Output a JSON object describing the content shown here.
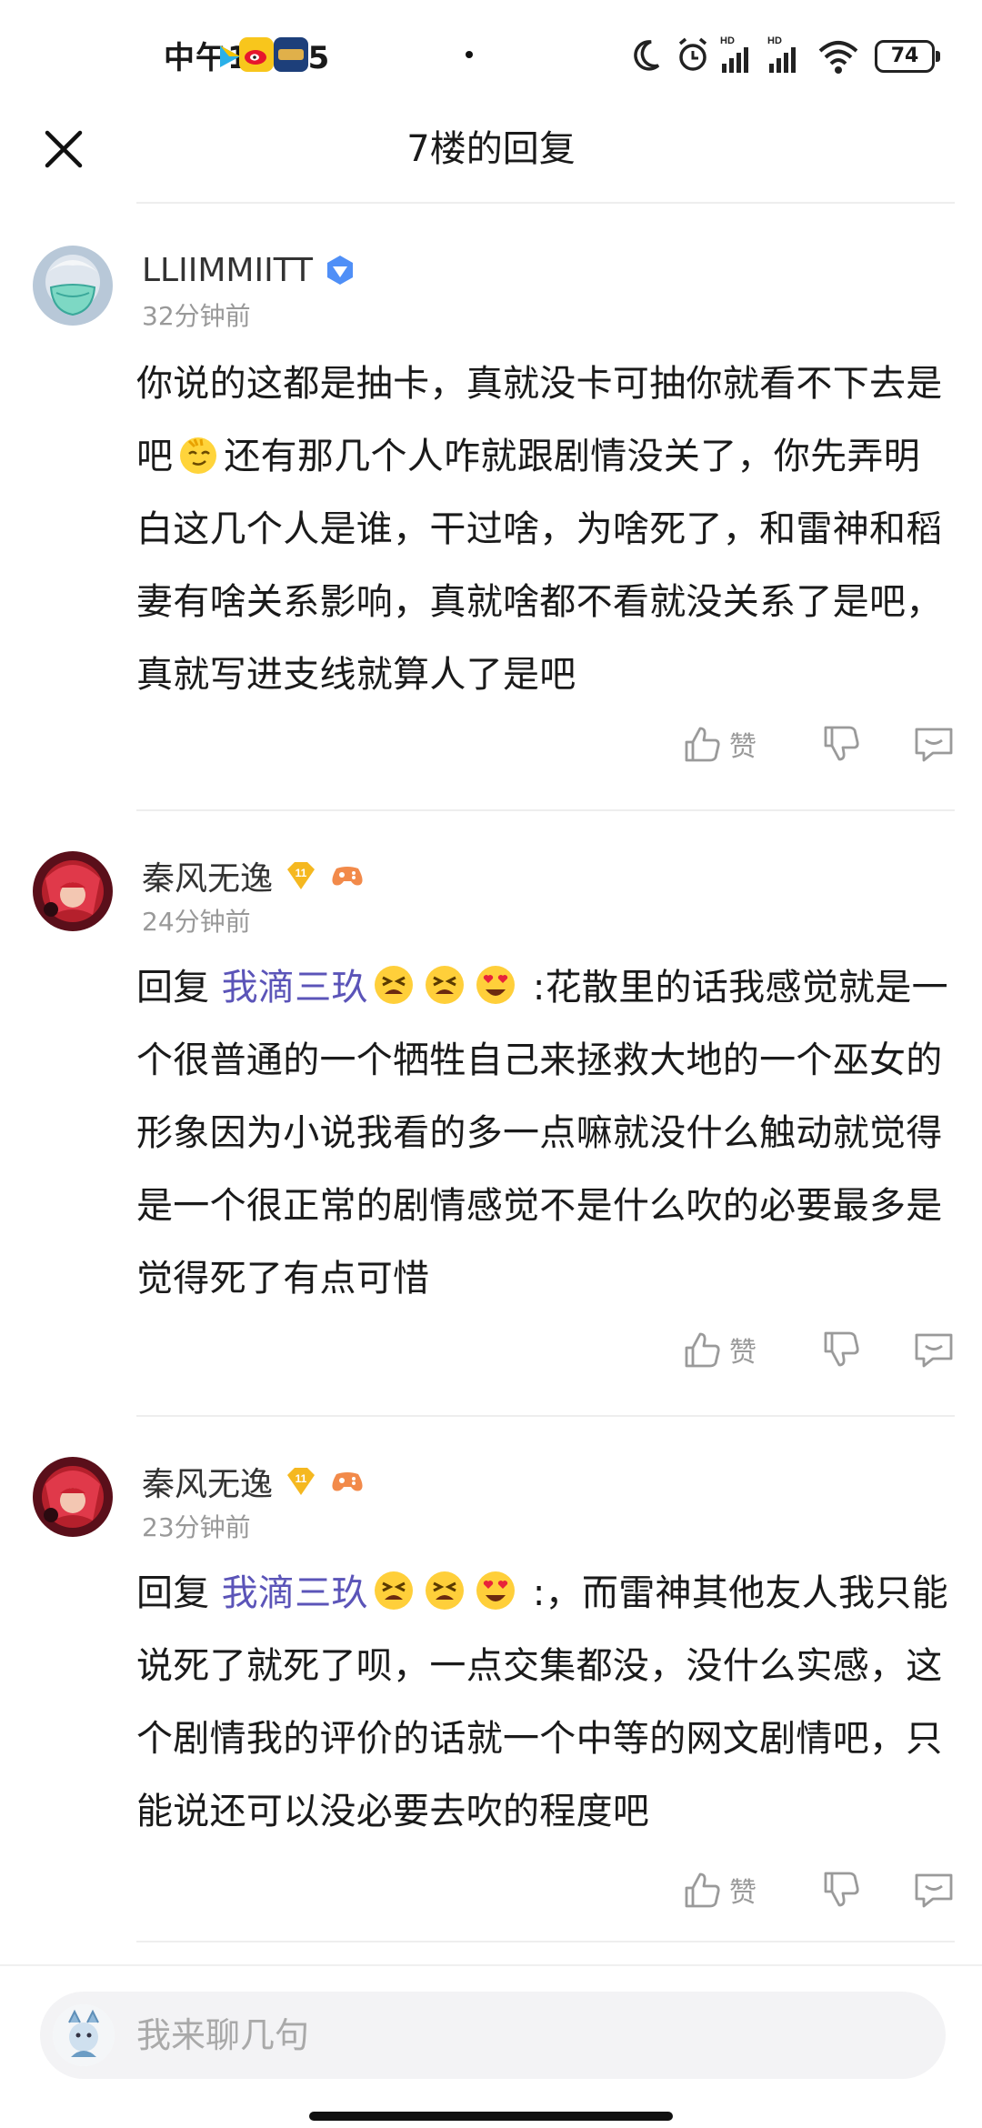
{
  "status_bar": {
    "time": "中午12:15",
    "battery": "74",
    "network_label": "HD"
  },
  "header": {
    "title": "7楼的回复",
    "close_icon": "close-icon"
  },
  "comments": [
    {
      "username": "LLIIMMIITT",
      "badge": "verified-diamond",
      "time": "32分钟前",
      "reply_prefix": "",
      "mention": "",
      "text_before_emoji": "你说的这都是抽卡，真就没卡可抽你就看不下去是吧",
      "text_after_emoji": "还有那几个人咋就跟剧情没关了，你先弄明白这几个人是谁，干过啥，为啥死了，和雷神和稻妻有啥关系影响，真就啥都不看就没关系了是吧，真就写进支线就算人了是吧",
      "like_label": "赞"
    },
    {
      "username": "秦风无逸",
      "level": "11",
      "time": "24分钟前",
      "reply_prefix": "回复",
      "mention": "我滴三玖",
      "text": ":花散里的话我感觉就是一个很普通的一个牺牲自己来拯救大地的一个巫女的形象因为小说我看的多一点嘛就没什么触动就觉得是一个很正常的剧情感觉不是什么吹的必要最多是觉得死了有点可惜",
      "like_label": "赞"
    },
    {
      "username": "秦风无逸",
      "level": "11",
      "time": "23分钟前",
      "reply_prefix": "回复",
      "mention": "我滴三玖",
      "text": ":，而雷神其他友人我只能说死了就死了呗，一点交集都没，没什么实感，这个剧情我的评价的话就一个中等的网文剧情吧，只能说还可以没必要去吹的程度吧",
      "like_label": "赞"
    }
  ],
  "input": {
    "placeholder": "我来聊几句"
  },
  "colors": {
    "mention": "#5b54b8",
    "timestamp": "#999999",
    "level_badge": "#f5b820"
  }
}
